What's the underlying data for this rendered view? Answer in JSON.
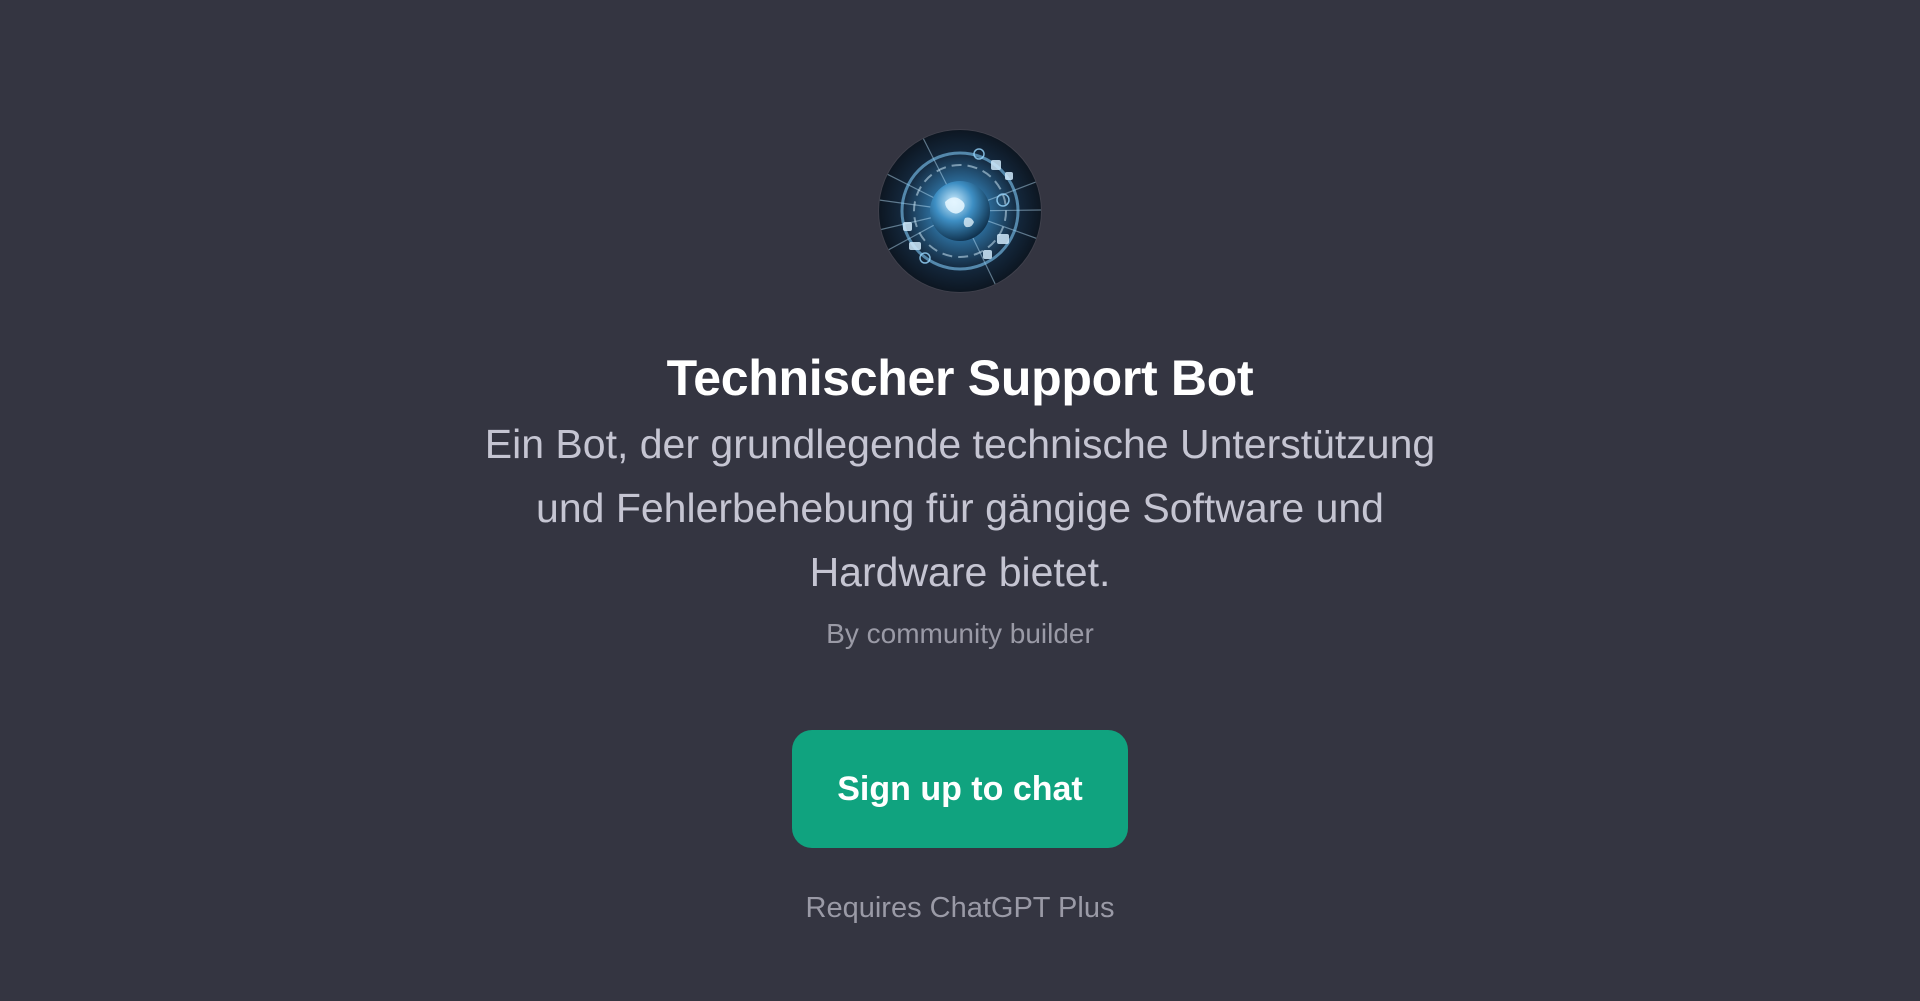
{
  "gpt": {
    "name": "Technischer Support Bot",
    "description": "Ein Bot, der grundlegende technische Unterstützung und Fehlerbehebung für gängige Software und Hardware bietet.",
    "author": "By community builder",
    "avatar_icon": "globe-circuit-icon"
  },
  "actions": {
    "signup_label": "Sign up to chat"
  },
  "footer": {
    "requirement": "Requires ChatGPT Plus"
  },
  "colors": {
    "background": "#343541",
    "accent": "#10a37f",
    "title": "#ffffff",
    "description": "#c5c5d2",
    "muted": "#9a9aa6"
  }
}
